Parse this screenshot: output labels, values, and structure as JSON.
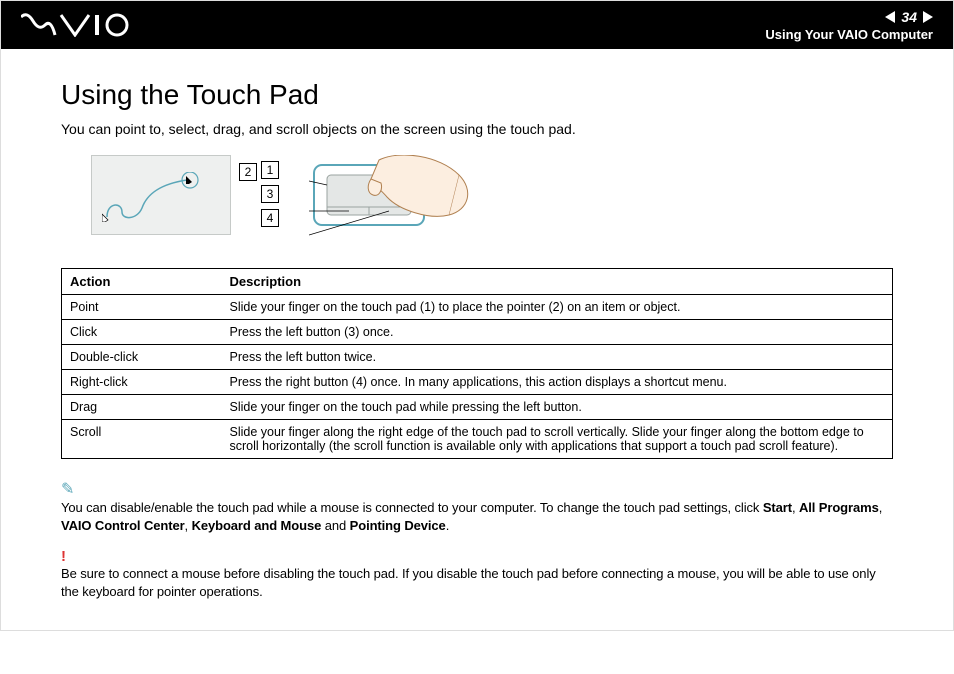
{
  "header": {
    "page_number": "34",
    "breadcrumb": "Using Your VAIO Computer"
  },
  "page": {
    "title": "Using the Touch Pad",
    "intro": "You can point to, select, drag, and scroll objects on the screen using the touch pad."
  },
  "callouts": {
    "c1": "1",
    "c2": "2",
    "c3": "3",
    "c4": "4"
  },
  "table": {
    "col_action": "Action",
    "col_desc": "Description",
    "rows": [
      {
        "action": "Point",
        "desc": "Slide your finger on the touch pad (1) to place the pointer (2) on an item or object."
      },
      {
        "action": "Click",
        "desc": "Press the left button (3) once."
      },
      {
        "action": "Double-click",
        "desc": "Press the left button twice."
      },
      {
        "action": "Right-click",
        "desc": "Press the right button (4) once. In many applications, this action displays a shortcut menu."
      },
      {
        "action": "Drag",
        "desc": "Slide your finger on the touch pad while pressing the left button."
      },
      {
        "action": "Scroll",
        "desc": "Slide your finger along the right edge of the touch pad to scroll vertically. Slide your finger along the bottom edge to scroll horizontally (the scroll function is available only with applications that support a touch pad scroll feature)."
      }
    ]
  },
  "note1": {
    "t0": "You can disable/enable the touch pad while a mouse is connected to your computer. To change the touch pad settings, click ",
    "b1": "Start",
    "s1": ", ",
    "b2": "All Programs",
    "s2": ", ",
    "b3": "VAIO Control Center",
    "s3": ", ",
    "b4": "Keyboard and Mouse",
    "s4": " and ",
    "b5": "Pointing Device",
    "s5": "."
  },
  "note2": "Be sure to connect a mouse before disabling the touch pad. If you disable the touch pad before connecting a mouse, you will be able to use only the keyboard for pointer operations."
}
